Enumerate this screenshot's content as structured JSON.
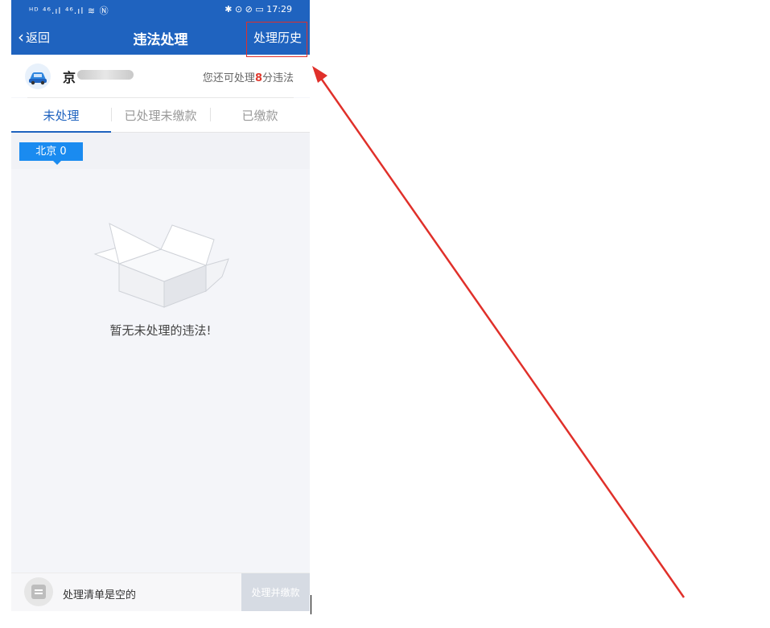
{
  "status_bar": {
    "left_icons": "ᴴᴰ ⁴⁶.ıl ⁴⁶.ıl ≋ Ⓝ",
    "right_icons": "✱ ⊙ ⊘ ▭",
    "time": "17:29"
  },
  "header": {
    "back_label": "返回",
    "title": "违法处理",
    "history_label": "处理历史"
  },
  "vehicle": {
    "plate_prefix": "京",
    "points_prefix": "您还可处理",
    "points_value": "8",
    "points_suffix": "分违法"
  },
  "tabs": [
    {
      "label": "未处理",
      "active": true
    },
    {
      "label": "已处理未缴款",
      "active": false
    },
    {
      "label": "已缴款",
      "active": false
    }
  ],
  "region": {
    "label": "北京 0"
  },
  "empty_state": {
    "message": "暂无未处理的违法!"
  },
  "bottom_bar": {
    "cart_text": "处理清单是空的",
    "pay_label": "处理并缴款"
  },
  "colors": {
    "primary": "#1f63bf",
    "tag_blue": "#1a8bf0",
    "annotation_red": "#e0302a",
    "points_red": "#e03a2f"
  }
}
